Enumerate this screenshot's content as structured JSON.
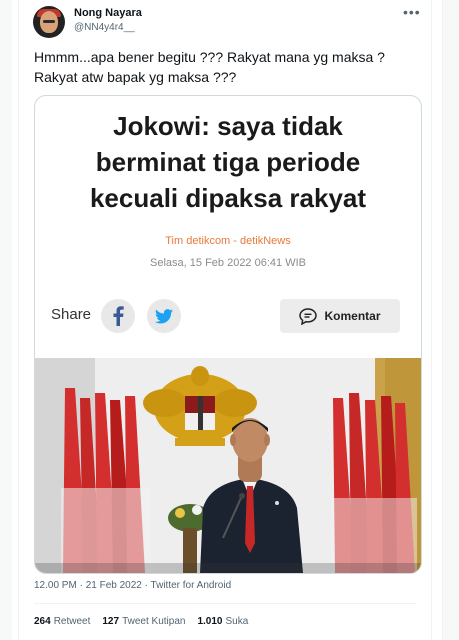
{
  "user": {
    "name": "Nong Nayara",
    "handle": "@NN4y4r4__"
  },
  "more_icon": "more-horizontal-icon",
  "tweet_text": "Hmmm...apa bener begitu ??? Rakyat mana yg maksa ? Rakyat atw bapak yg maksa ???",
  "card": {
    "headline_lines": [
      "Jokowi: saya tidak",
      "berminat tiga periode",
      "kecuali dipaksa rakyat"
    ],
    "source": "Tim detikcom - detikNews",
    "date": "Selasa, 15 Feb 2022 06:41 WIB",
    "share_label": "Share",
    "komentar_label": "Komentar",
    "colors": {
      "source": "#e8793a",
      "facebook": "#3b5998",
      "twitter": "#1da1f2"
    }
  },
  "meta": "12.00 PM · 21 Feb 2022 · Twitter for Android",
  "stats": {
    "retweets": {
      "count": "264",
      "label": "Retweet"
    },
    "quotes": {
      "count": "127",
      "label": "Tweet Kutipan"
    },
    "likes": {
      "count": "1.010",
      "label": "Suka"
    }
  }
}
